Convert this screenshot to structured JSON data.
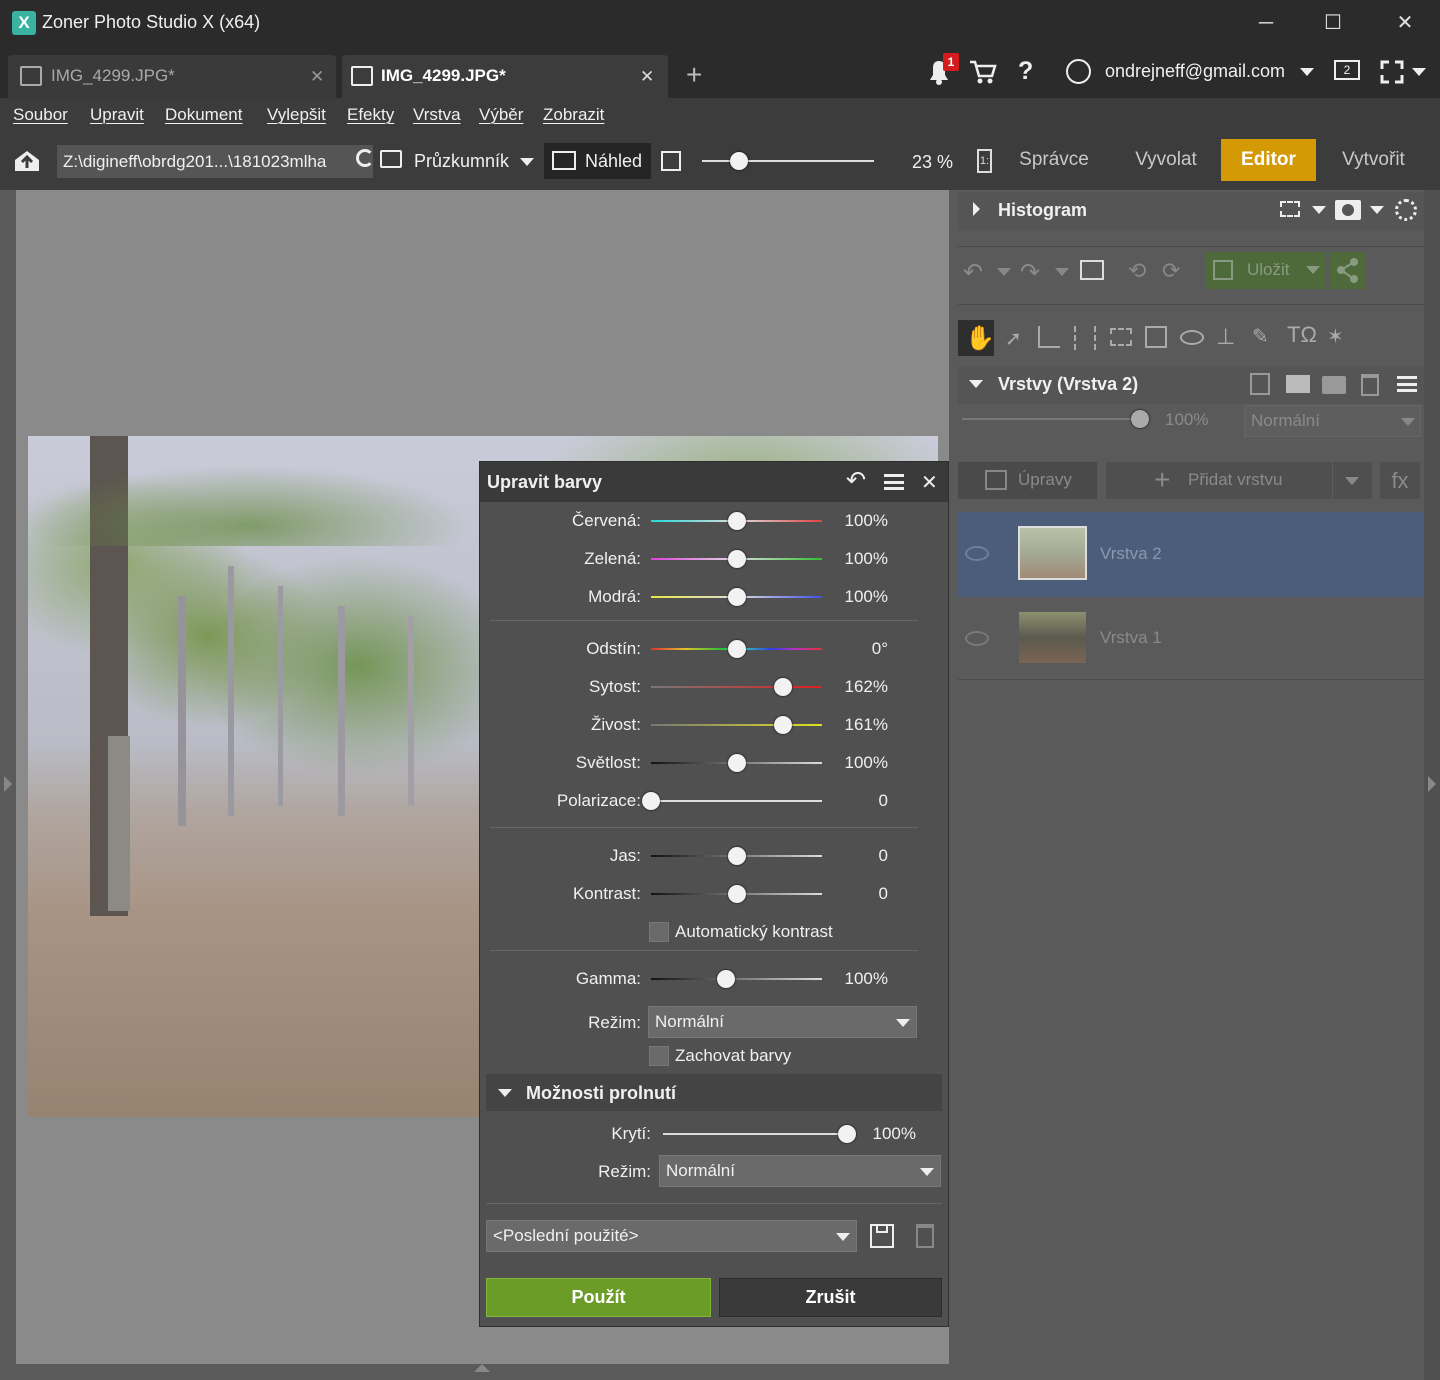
{
  "window": {
    "app_icon": "X",
    "title": "Zoner Photo Studio X (x64)",
    "minimize": "─",
    "maximize": "☐",
    "close": "✕"
  },
  "tabs": [
    {
      "label": "IMG_4299.JPG*",
      "close": "✕",
      "active": false
    },
    {
      "label": "IMG_4299.JPG*",
      "close": "✕",
      "active": true
    }
  ],
  "new_tab": "+",
  "top_right": {
    "notification_count": "1",
    "help": "?",
    "account": "ondrejneff@gmail.com",
    "monitor_number": "2"
  },
  "menu": [
    "Soubor",
    "Upravit",
    "Dokument",
    "Vylepšit",
    "Efekty",
    "Vrstva",
    "Výběr",
    "Zobrazit"
  ],
  "toolbar": {
    "path": "Z:\\digineff\\obrdg201...\\181023mlha",
    "explorer": "Průzkumník",
    "preview": "Náhled",
    "zoom": "23 %",
    "ratio_icon": "1:",
    "modules": [
      "Správce",
      "Vyvolat",
      "Editor",
      "Vytvořit"
    ],
    "active_module": "Editor"
  },
  "right_panel": {
    "histogram": "Histogram",
    "save": "Uložit",
    "layers_title": "Vrstvy (Vrstva 2)",
    "opacity": "100%",
    "blend_mode": "Normální",
    "adjustments": "Úpravy",
    "add_layer": "Přidat vrstvu",
    "fx": "fx",
    "text_tool": "TΩ",
    "layers": [
      {
        "name": "Vrstva 2",
        "selected": true
      },
      {
        "name": "Vrstva 1",
        "selected": false
      }
    ]
  },
  "dialog": {
    "title": "Upravit barvy",
    "groups": {
      "color": [
        {
          "label": "Červená:",
          "value": "100%",
          "level": 0.5
        },
        {
          "label": "Zelená:",
          "value": "100%",
          "level": 0.5
        },
        {
          "label": "Modrá:",
          "value": "100%",
          "level": 0.5
        }
      ],
      "hsl": [
        {
          "label": "Odstín:",
          "value": "0°",
          "level": 0.5
        },
        {
          "label": "Sytost:",
          "value": "162%",
          "level": 0.77
        },
        {
          "label": "Živost:",
          "value": "161%",
          "level": 0.77
        },
        {
          "label": "Světlost:",
          "value": "100%",
          "level": 0.5
        },
        {
          "label": "Polarizace:",
          "value": "0",
          "level": 0.0
        }
      ],
      "tone": [
        {
          "label": "Jas:",
          "value": "0",
          "level": 0.5
        },
        {
          "label": "Kontrast:",
          "value": "0",
          "level": 0.5
        }
      ],
      "gamma": {
        "label": "Gamma:",
        "value": "100%",
        "level": 0.44
      }
    },
    "auto_contrast": "Automatický kontrast",
    "mode_label": "Režim:",
    "mode_value": "Normální",
    "keep_colors": "Zachovat barvy",
    "blend_section": "Možnosti prolnutí",
    "opacity_label": "Krytí:",
    "opacity_value": "100%",
    "opacity_level": 1.0,
    "blend_mode_label": "Režim:",
    "blend_mode_value": "Normální",
    "preset": "<Poslední použité>",
    "apply": "Použít",
    "cancel": "Zrušit"
  },
  "colors": {
    "accent_orange": "#d49a06",
    "apply_green": "#6c9c28",
    "layer_selected": "#4b5d7a"
  }
}
